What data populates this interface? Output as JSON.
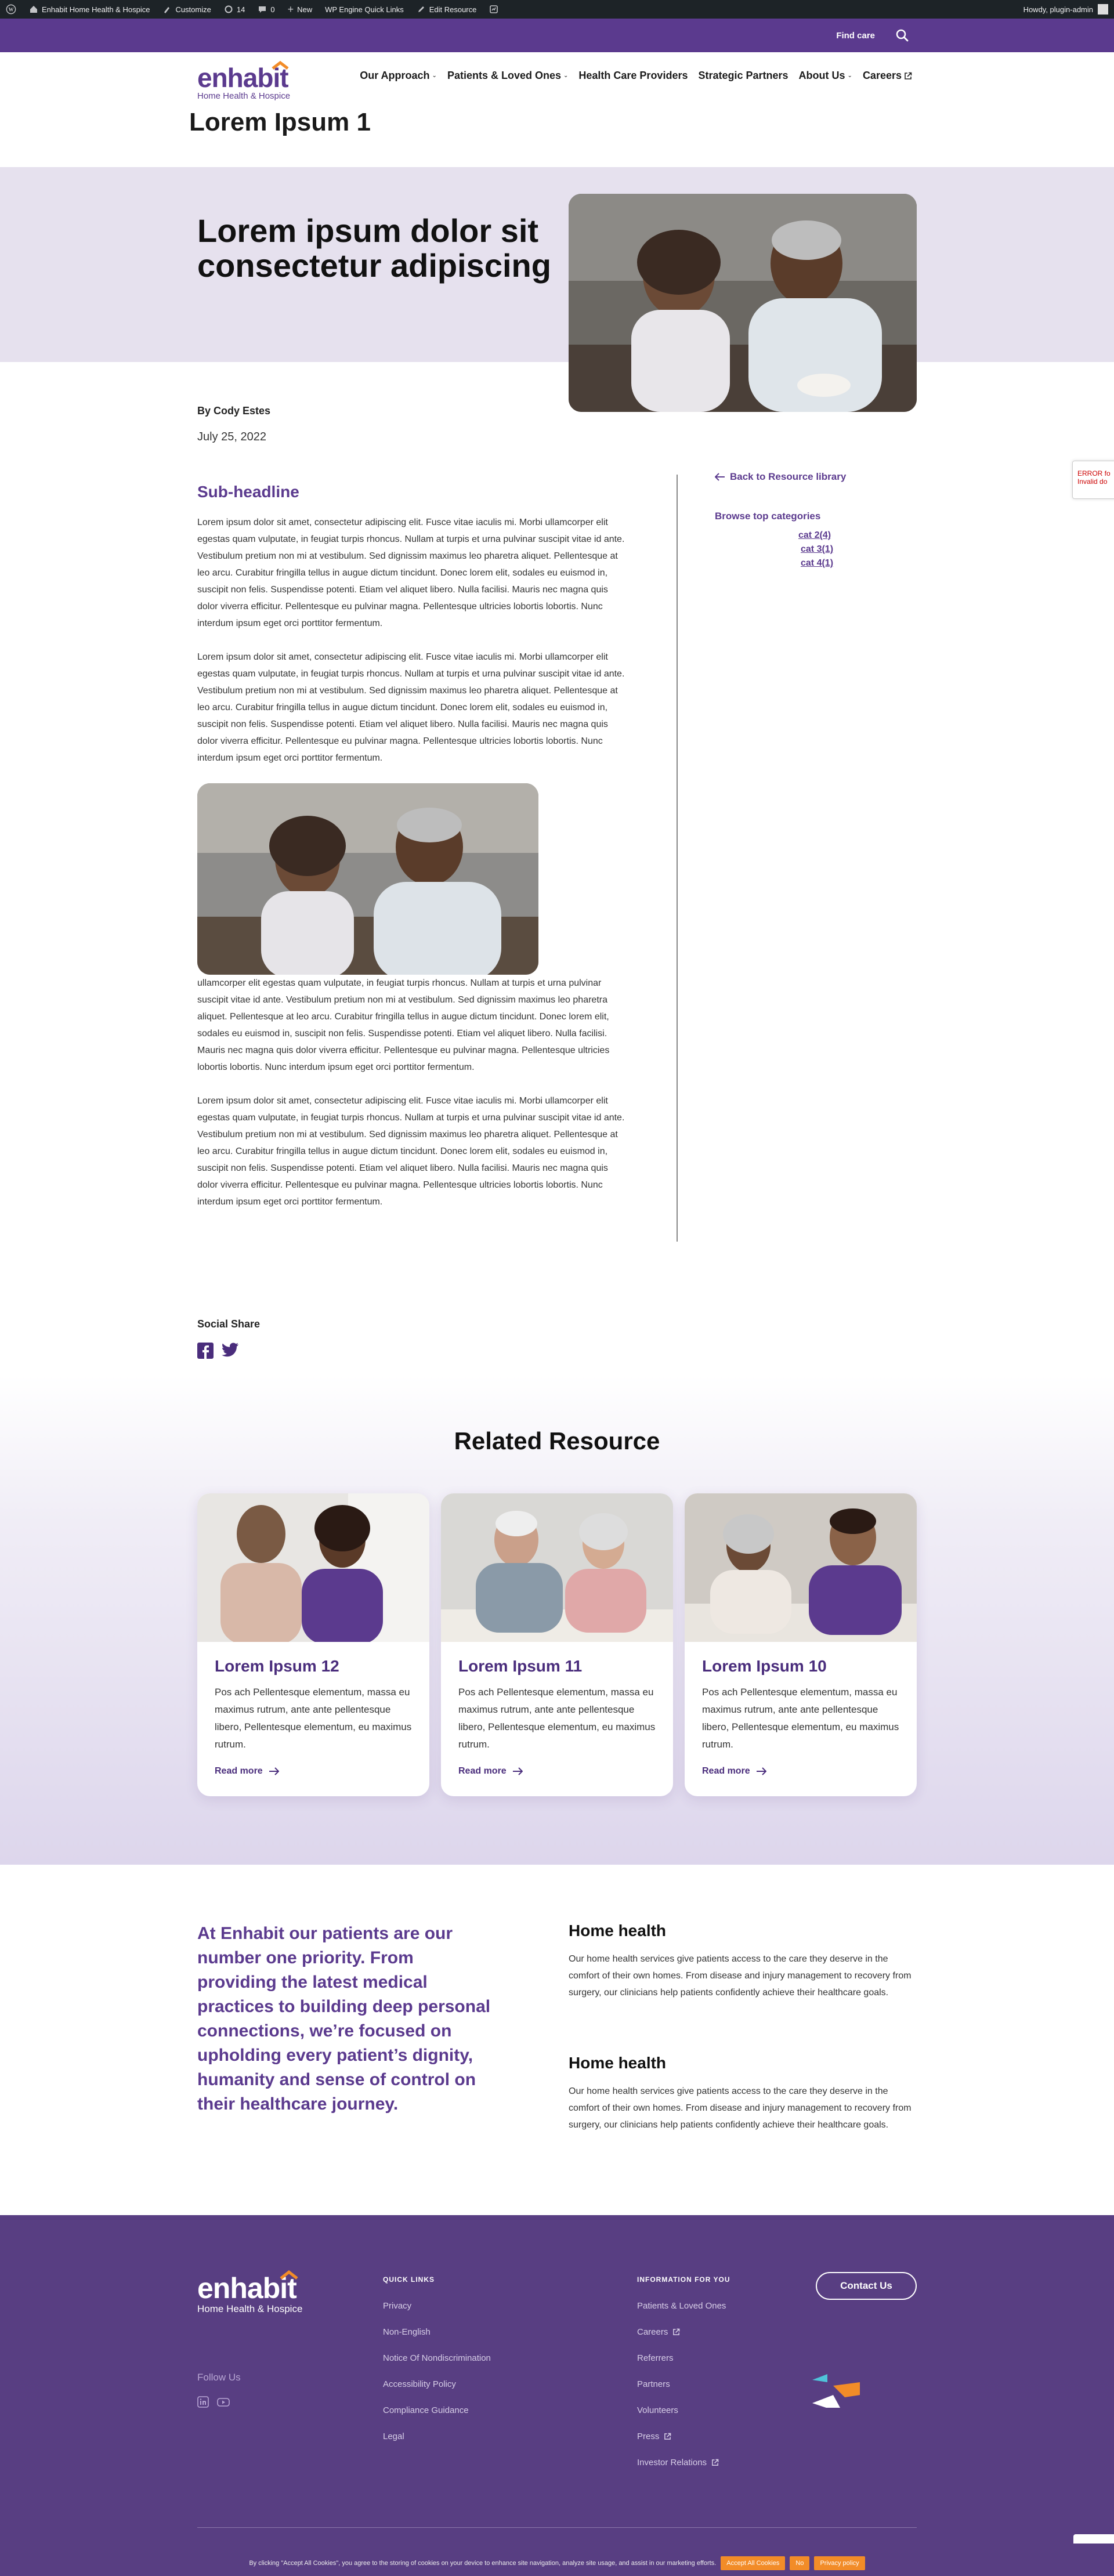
{
  "admin_bar": {
    "site_name": "Enhabit Home Health & Hospice",
    "customize": "Customize",
    "comments_count": "14",
    "pending_count": "0",
    "new": "New",
    "quick_links": "WP Engine Quick Links",
    "edit": "Edit Resource",
    "howdy": "Howdy, plugin-admin"
  },
  "utility": {
    "find_care": "Find care"
  },
  "brand": {
    "logo_word": "enhabit",
    "logo_sub": "Home Health & Hospice",
    "primary": "#5b3a8e",
    "accent": "#f28c28"
  },
  "nav": {
    "items": [
      {
        "label": "Our Approach",
        "dropdown": "⌄"
      },
      {
        "label": "Patients & Loved Ones",
        "dropdown": "⌄"
      },
      {
        "label": "Health Care Providers"
      },
      {
        "label": "Strategic Partners"
      },
      {
        "label": "About Us",
        "dropdown": "⌄"
      },
      {
        "label": "Careers"
      }
    ]
  },
  "page": {
    "title": "Lorem Ipsum 1"
  },
  "hero": {
    "title": "Lorem ipsum dolor sit consectetur adipiscing"
  },
  "meta": {
    "author": "By Cody Estes",
    "date": "July 25, 2022"
  },
  "article": {
    "subheadline": "Sub-headline",
    "p1": "Lorem ipsum dolor sit amet, consectetur adipiscing elit. Fusce vitae iaculis mi. Morbi ullamcorper elit egestas quam vulputate, in feugiat turpis rhoncus. Nullam at turpis et urna pulvinar suscipit vitae id ante. Vestibulum pretium non mi at vestibulum. Sed dignissim maximus leo pharetra aliquet. Pellentesque at leo arcu. Curabitur fringilla tellus in augue dictum tincidunt. Donec lorem elit, sodales eu euismod in, suscipit non felis. Suspendisse potenti. Etiam vel aliquet libero. Nulla facilisi. Mauris nec magna quis dolor viverra efficitur. Pellentesque eu pulvinar magna. Pellentesque ultricies lobortis lobortis. Nunc interdum ipsum eget orci porttitor fermentum.",
    "p2": "Lorem ipsum dolor sit amet, consectetur adipiscing elit. Fusce vitae iaculis mi. Morbi ullamcorper elit egestas quam vulputate, in feugiat turpis rhoncus. Nullam at turpis et urna pulvinar suscipit vitae id ante. Vestibulum pretium non mi at vestibulum. Sed dignissim maximus leo pharetra aliquet. Pellentesque at leo arcu. Curabitur fringilla tellus in augue dictum tincidunt. Donec lorem elit, sodales eu euismod in, suscipit non felis. Suspendisse potenti. Etiam vel aliquet libero. Nulla facilisi. Mauris nec magna quis dolor viverra efficitur. Pellentesque eu pulvinar magna. Pellentesque ultricies lobortis lobortis. Nunc interdum ipsum eget orci porttitor fermentum.",
    "p3": "ullamcorper elit egestas quam vulputate, in feugiat turpis rhoncus. Nullam at turpis et urna pulvinar suscipit vitae id ante. Vestibulum pretium non mi at vestibulum. Sed dignissim maximus leo pharetra aliquet. Pellentesque at leo arcu. Curabitur fringilla tellus in augue dictum tincidunt. Donec lorem elit, sodales eu euismod in, suscipit non felis. Suspendisse potenti. Etiam vel aliquet libero. Nulla facilisi. Mauris nec magna quis dolor viverra efficitur. Pellentesque eu pulvinar magna. Pellentesque ultricies lobortis lobortis. Nunc interdum ipsum eget orci porttitor fermentum.",
    "p4": "Lorem ipsum dolor sit amet, consectetur adipiscing elit. Fusce vitae iaculis mi. Morbi ullamcorper elit egestas quam vulputate, in feugiat turpis rhoncus. Nullam at turpis et urna pulvinar suscipit vitae id ante. Vestibulum pretium non mi at vestibulum. Sed dignissim maximus leo pharetra aliquet. Pellentesque at leo arcu. Curabitur fringilla tellus in augue dictum tincidunt. Donec lorem elit, sodales eu euismod in, suscipit non felis. Suspendisse potenti. Etiam vel aliquet libero. Nulla facilisi. Mauris nec magna quis dolor viverra efficitur. Pellentesque eu pulvinar magna. Pellentesque ultricies lobortis lobortis. Nunc interdum ipsum eget orci porttitor fermentum."
  },
  "sidebar": {
    "back": "Back to Resource library",
    "browse": "Browse top categories",
    "categories": [
      "cat 2(4)",
      "cat 3(1)",
      "cat 4(1)"
    ]
  },
  "error_widget": {
    "line1": "ERROR fo",
    "line2": "Invalid do"
  },
  "social": {
    "title": "Social Share",
    "icons": [
      "facebook-icon",
      "twitter-icon"
    ]
  },
  "related": {
    "title": "Related Resource",
    "read_more": "Read more",
    "cards": [
      {
        "title": "Lorem Ipsum 12",
        "text": "Pos ach Pellentesque elementum, massa eu maximus rutrum, ante ante pellentesque libero, Pellentesque elementum, eu maximus rutrum."
      },
      {
        "title": "Lorem Ipsum 11",
        "text": "Pos ach Pellentesque elementum, massa eu maximus rutrum, ante ante pellentesque libero, Pellentesque elementum, eu maximus rutrum."
      },
      {
        "title": "Lorem Ipsum 10",
        "text": "Pos ach Pellentesque elementum, massa eu maximus rutrum, ante ante pellentesque libero, Pellentesque elementum, eu maximus rutrum."
      }
    ]
  },
  "mission": {
    "text": "At Enhabit our patients are our number one priority. From providing the latest medical practices to building deep personal connections, we’re focused on upholding every patient’s dignity, humanity and sense of control on their healthcare journey."
  },
  "services": [
    {
      "title": "Home health",
      "text": "Our home health services give patients access to the care they deserve in the comfort of their own homes. From disease and injury management to recovery from surgery, our clinicians help patients confidently achieve their healthcare goals."
    },
    {
      "title": "Home health",
      "text": "Our home health services give patients access to the care they deserve in the comfort of their own homes. From disease and injury management to recovery from surgery, our clinicians help patients confidently achieve their healthcare goals."
    }
  ],
  "footer": {
    "follow": "Follow Us",
    "quick_links_title": "QUICK LINKS",
    "quick_links": [
      "Privacy",
      "Non-English",
      "Notice Of Nondiscrimination",
      "Accessibility Policy",
      "Compliance Guidance",
      "Legal"
    ],
    "info_title": "INFORMATION FOR YOU",
    "info_links": [
      "Patients & Loved Ones",
      "Careers",
      "Referrers",
      "Partners",
      "Volunteers",
      "Press",
      "Investor Relations"
    ],
    "contact": "Contact Us"
  },
  "cookie": {
    "text": "By clicking \"Accept All Cookies\", you agree to the storing of cookies on your device to enhance site navigation, analyze site usage, and assist in our marketing efforts.",
    "accept": "Accept All Cookies",
    "no": "No",
    "privacy": "Privacy policy"
  }
}
